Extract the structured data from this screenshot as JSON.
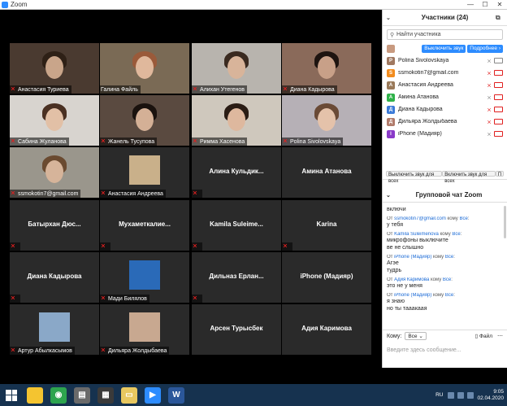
{
  "window": {
    "title": "Zoom",
    "min": "—",
    "max": "☐",
    "close": "✕"
  },
  "gallery": {
    "rows": [
      [
        {
          "name": "Анастасия Туриева",
          "muted": true,
          "video": true,
          "bg": "#4a3a30",
          "face": "#c9a58a",
          "hair": "#2e2016"
        },
        {
          "name": "Галина Файль",
          "muted": false,
          "video": true,
          "active": true,
          "bg": "#7a6a55",
          "face": "#e0b89c",
          "hair": "#9a5a3a"
        },
        {
          "name": "Алихан Утегенов",
          "muted": true,
          "video": true,
          "bg": "#b8b4ae",
          "face": "#d8b49a",
          "hair": "#3a2a20"
        },
        {
          "name": "Диана Кадырова",
          "muted": true,
          "video": true,
          "bg": "#8a6a5a",
          "face": "#c8a088",
          "hair": "#1e1410"
        }
      ],
      [
        {
          "name": "Сабина Жуланова",
          "muted": true,
          "video": true,
          "bg": "#d8d4cf",
          "face": "#e2c0a6",
          "hair": "#4a3022"
        },
        {
          "name": "Жанель Тусупова",
          "muted": true,
          "video": true,
          "bg": "#5a4a40",
          "face": "#d4b096",
          "hair": "#1a120e"
        },
        {
          "name": "Римма Хасенова",
          "muted": true,
          "video": true,
          "bg": "#cfc8bd",
          "face": "#deb89e",
          "hair": "#2a1c14"
        },
        {
          "name": "Polina Sivolovskaya",
          "muted": true,
          "video": true,
          "bg": "#b6b0b6",
          "face": "#e4c2aa",
          "hair": "#6a4a36"
        }
      ],
      [
        {
          "name": "ssmokotin7@gmail.com",
          "muted": true,
          "video": true,
          "bg": "#9a968c",
          "face": "#d6b49a",
          "hair": "#6a4a30"
        },
        {
          "name": "Анастасия Андреева",
          "muted": true,
          "video": false,
          "thumb": "#c9b08a"
        },
        {
          "name": "Алина Кульдик...",
          "muted": true,
          "video": false
        },
        {
          "name": "Амина Атанова",
          "muted": false,
          "video": false
        }
      ],
      [
        {
          "name": "Батырхан Дюс...",
          "muted": true,
          "video": false
        },
        {
          "name": "Мухаметкалие...",
          "muted": true,
          "video": false
        },
        {
          "name": "Kamila Suleime...",
          "muted": true,
          "video": false
        },
        {
          "name": "Karina",
          "muted": true,
          "video": false
        }
      ],
      [
        {
          "name": "Диана Кадырова",
          "muted": true,
          "video": false
        },
        {
          "name": "Мади Билялов",
          "muted": true,
          "video": false,
          "thumb": "#2a6ab8"
        },
        {
          "name": "Дильназ Ерлан...",
          "muted": true,
          "video": false
        },
        {
          "name": "iPhone (Мадияр)",
          "muted": false,
          "video": false
        }
      ],
      [
        {
          "name": "Артур Абылкасымов",
          "muted": true,
          "video": false,
          "thumb": "#8aa8c8"
        },
        {
          "name": "Дильяра Жолдыбаева",
          "muted": true,
          "video": false,
          "thumb": "#c8a890"
        },
        {
          "name": "Арсен Турысбек",
          "muted": false,
          "video": false
        },
        {
          "name": "Адия Каримова",
          "muted": false,
          "video": false
        }
      ]
    ]
  },
  "participants": {
    "title": "Участники (24)",
    "search_placeholder": "Найти участника",
    "host_mute_btn": "Выключить звук",
    "host_more_btn": "Подробнее",
    "list": [
      {
        "name": "Polina Sivolovskaya",
        "avatar": "P",
        "color": "#a07860",
        "photo": true,
        "mic_gray": true,
        "cam_gray": true
      },
      {
        "name": "ssmokotin7@gmail.com",
        "avatar": "S",
        "color": "#f28c1e",
        "mic_gray": false,
        "cam_gray": false
      },
      {
        "name": "Анастасия Андреева",
        "avatar": "А",
        "color": "#9a7a5a",
        "photo": true,
        "mic_gray": false,
        "cam_gray": false
      },
      {
        "name": "Амина Атанова",
        "avatar": "А",
        "color": "#2fb24a",
        "mic_gray": true,
        "cam_gray": false
      },
      {
        "name": "Диана Кадырова",
        "avatar": "Д",
        "color": "#3a7ad8",
        "mic_gray": false,
        "cam_gray": false
      },
      {
        "name": "Дильяра Жолдыбаева",
        "avatar": "Д",
        "color": "#b07a6a",
        "photo": true,
        "mic_gray": false,
        "cam_gray": false
      },
      {
        "name": "iPhone (Мадияр)",
        "avatar": "I",
        "color": "#8a3ac8",
        "mic_gray": true,
        "cam_gray": false
      }
    ],
    "mute_all": "Выключить звук для всех",
    "unmute_all": "Включить звук для всех",
    "more": "П"
  },
  "chat": {
    "title": "Групповой чат Zoom",
    "messages": [
      {
        "from": "",
        "to": "",
        "lines": [
          "включи"
        ]
      },
      {
        "from": "ssmokotin7@gmail.com",
        "to": "Все",
        "lines": [
          "у тебя"
        ]
      },
      {
        "from": "Kamila Suleimenova",
        "to": "Все",
        "lines": [
          "микрофоны выключите",
          "ве не слышно"
        ]
      },
      {
        "from": "iPhone (Мадияр)",
        "to": "Все",
        "lines": [
          "Агэе",
          "тудрь"
        ]
      },
      {
        "from": "Адия Каримова",
        "to": "Все",
        "lines": [
          "это не у меня"
        ]
      },
      {
        "from": "iPhone (Мадияр)",
        "to": "Все",
        "lines": [
          "я знаю",
          "но ты тааакаая"
        ]
      }
    ],
    "prefix_from": "От",
    "prefix_to": "кому",
    "to_label": "Кому:",
    "to_value": "Все",
    "file_label": "Файл",
    "input_placeholder": "Введите здесь сообщение..."
  },
  "taskbar": {
    "lang": "RU",
    "time": "9:05",
    "date": "02.04.2020",
    "apps": [
      {
        "name": "explorer",
        "color": "#f4c430",
        "glyph": ""
      },
      {
        "name": "chrome",
        "color": "#2da44e",
        "glyph": "◉"
      },
      {
        "name": "printer",
        "color": "#6a6a6a",
        "glyph": "▤"
      },
      {
        "name": "app",
        "color": "#3a3a3a",
        "glyph": "▦"
      },
      {
        "name": "folder",
        "color": "#e8c860",
        "glyph": "▭"
      },
      {
        "name": "zoom",
        "color": "#2d8cff",
        "glyph": "▶"
      },
      {
        "name": "word",
        "color": "#2b579a",
        "glyph": "W"
      }
    ]
  }
}
